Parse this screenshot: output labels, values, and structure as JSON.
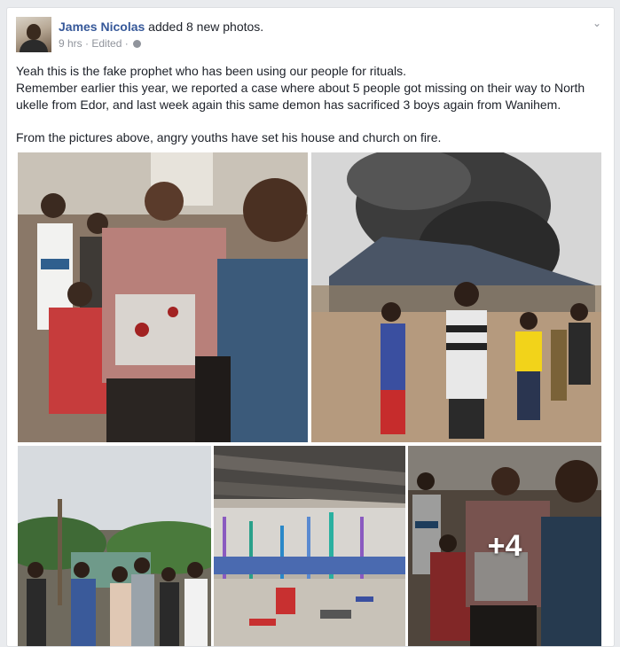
{
  "post": {
    "author_name": "James Nicolas",
    "action_text": " added 8 new photos.",
    "time": "9 hrs",
    "edited": "Edited",
    "separator": "·",
    "privacy_icon": "globe-icon",
    "options_icon": "chevron-down-icon",
    "text_lines": [
      "Yeah this is the fake prophet who has been using our people for rituals.",
      "Remember earlier this year, we reported a case where about 5 people got missing on their way to North ukelle from Edor, and last week again this same demon has sacrificed 3 boys again from Wanihem.",
      "From the pictures above, angry youths have set his house and church on fire."
    ],
    "more_photos_label": "+4"
  },
  "colors": {
    "author_link": "#365899",
    "meta_text": "#90949c",
    "background": "#e9ebee"
  }
}
